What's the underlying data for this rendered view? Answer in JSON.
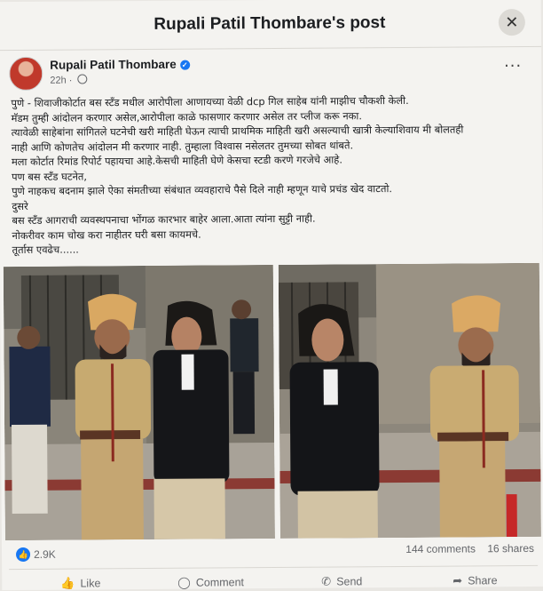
{
  "header": {
    "title": "Rupali Patil Thombare's post",
    "close_icon": "✕"
  },
  "post": {
    "author": "Rupali Patil Thombare",
    "time": "22h",
    "more": "···",
    "lines": [
      "पुणे - शिवाजीकोर्टात बस स्टँड मधील आरोपीला आणायच्या वेळी dcp गिल साहेब यांनी माझीच चौकशी केली.",
      "मॅडम तुम्ही आंदोलन करणार असेल,आरोपीला काळे फासणार करणार असेल तर प्लीज करू नका.",
      "त्यावेळी साहेबांना सांगितले घटनेची खरी माहिती घेऊन त्याची प्राथमिक माहिती खरी असल्याची खात्री केल्याशिवाय मी बोलतही",
      "नाही आणि कोणतेच आंदोलन मी करणार नाही. तुम्हाला विश्वास नसेलतर तुमच्या सोबत थांबते.",
      "मला कोर्टात रिमांड रिपोर्ट पहायचा आहे.केसची माहिती घेणे केसचा स्टडी करणे गरजेचे आहे.",
      "पण बस स्टँड घटनेत,",
      "पुणे नाहकच बदनाम झाले ऐका संमतीच्या संबंधात व्यवहाराचे पैसे दिले नाही म्हणून याचे प्रचंड खेद वाटतो.",
      "दुसरे",
      "बस स्टँड आगराची व्यवस्थपनाचा भोंगळ कारभार बाहेर आला.आता त्यांना सुट्टी नाही.",
      "नोकरीवर काम चोख करा नाहीतर घरी बसा कायमचे.",
      "तूर्तास एवढेच......"
    ]
  },
  "stats": {
    "likes": "2.9K",
    "comments": "144 comments",
    "shares": "16 shares"
  },
  "actions": {
    "like": "Like",
    "like_icon": "👍",
    "comment": "Comment",
    "comment_icon": "◯",
    "send": "Send",
    "send_icon": "✆",
    "share": "Share",
    "share_icon": "➦"
  }
}
